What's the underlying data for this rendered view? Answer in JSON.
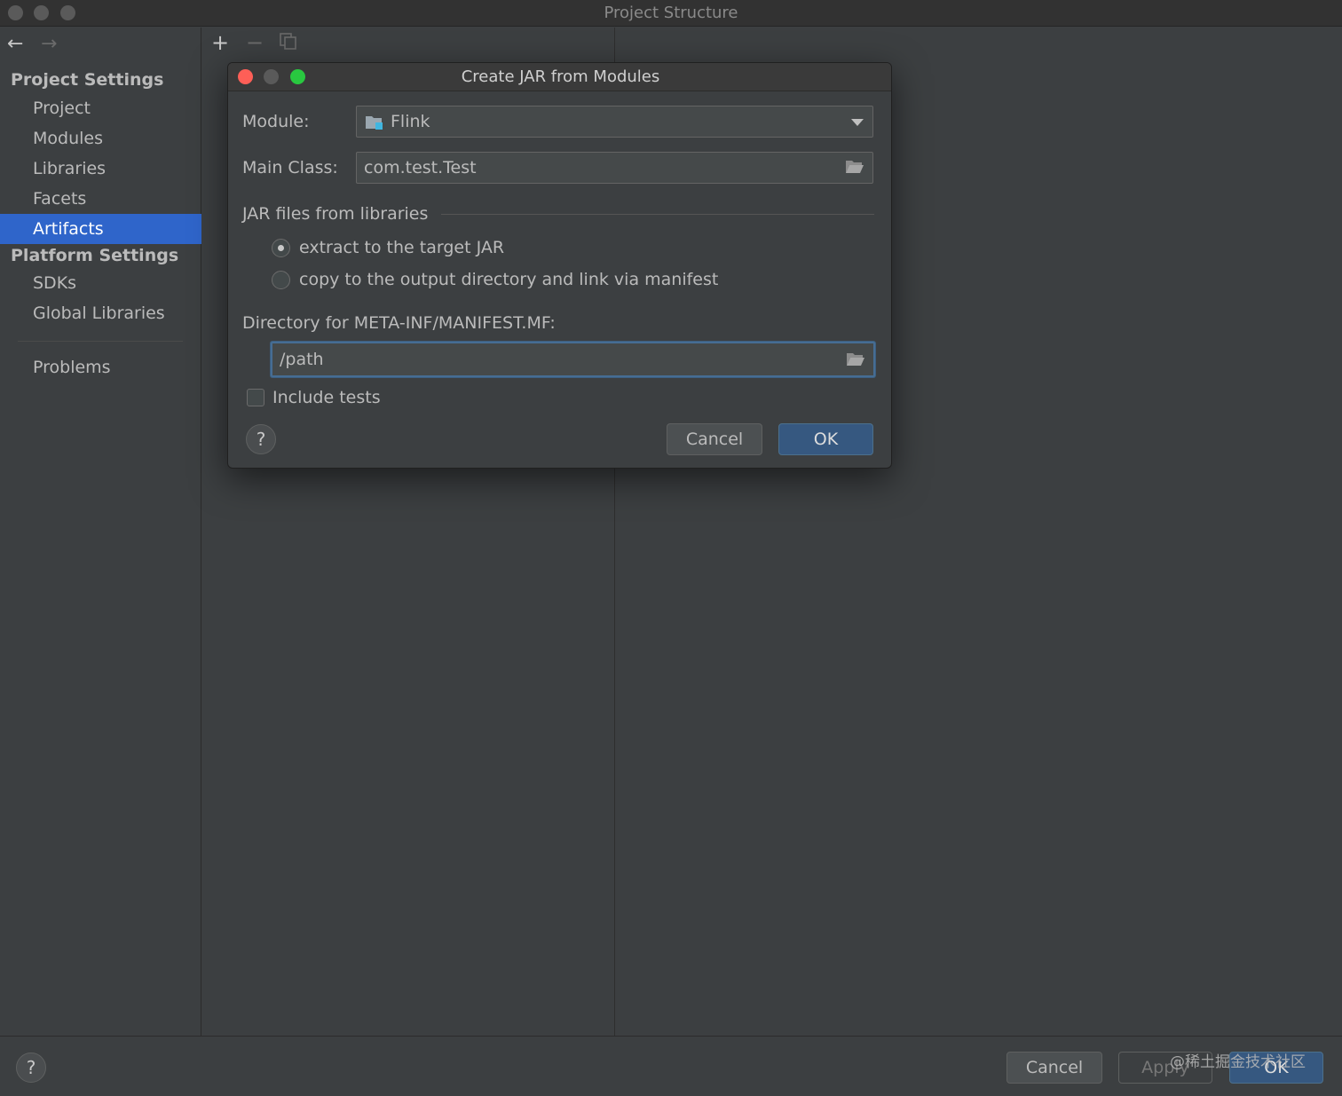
{
  "window": {
    "title": "Project Structure"
  },
  "sidebar": {
    "project_settings_header": "Project Settings",
    "project_items": [
      "Project",
      "Modules",
      "Libraries",
      "Facets",
      "Artifacts"
    ],
    "selected_item": "Artifacts",
    "platform_settings_header": "Platform Settings",
    "platform_items": [
      "SDKs",
      "Global Libraries"
    ],
    "problems": "Problems"
  },
  "toolbar": {
    "add": "+",
    "remove": "−"
  },
  "dialog": {
    "title": "Create JAR from Modules",
    "module_label": "Module:",
    "module_value": "Flink",
    "main_class_label": "Main Class:",
    "main_class_value": "com.test.Test",
    "jar_group_label": "JAR files from libraries",
    "radio_extract": "extract to the target JAR",
    "radio_copy": "copy to the output directory and link via manifest",
    "selected_radio": "extract",
    "manifest_label": "Directory for META-INF/MANIFEST.MF:",
    "manifest_value": "/path",
    "include_tests_label": "Include tests",
    "include_tests_checked": false,
    "help": "?",
    "cancel": "Cancel",
    "ok": "OK"
  },
  "footer": {
    "help": "?",
    "cancel": "Cancel",
    "apply": "Apply",
    "ok": "OK"
  },
  "watermark": "@稀土掘金技术社区",
  "colors": {
    "background": "#3c3f41",
    "selection": "#2f65ca",
    "primary_button": "#365880",
    "traffic_red": "#fe5f57",
    "traffic_green": "#29c840",
    "focus_border": "#466d94"
  }
}
